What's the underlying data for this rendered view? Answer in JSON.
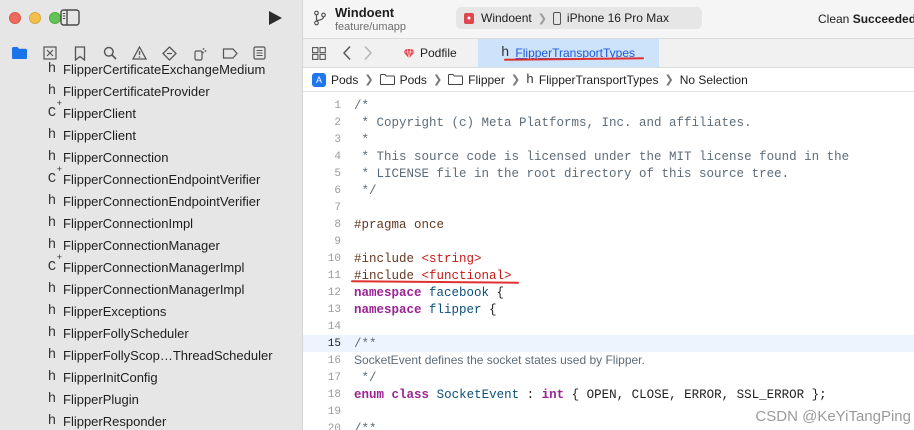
{
  "window": {
    "project": "Windoent",
    "branch": "feature/umapp",
    "scheme": "Windoent",
    "device": "iPhone 16 Pro Max",
    "status_prefix": "Clean ",
    "status_strong": "Succeeded"
  },
  "navigator": {
    "files": [
      {
        "badge": "h",
        "name": "FlipperCertificateExchangeMedium"
      },
      {
        "badge": "h",
        "name": "FlipperCertificateProvider"
      },
      {
        "badge": "C",
        "name": "FlipperClient"
      },
      {
        "badge": "h",
        "name": "FlipperClient"
      },
      {
        "badge": "h",
        "name": "FlipperConnection"
      },
      {
        "badge": "C",
        "name": "FlipperConnectionEndpointVerifier"
      },
      {
        "badge": "h",
        "name": "FlipperConnectionEndpointVerifier"
      },
      {
        "badge": "h",
        "name": "FlipperConnectionImpl"
      },
      {
        "badge": "h",
        "name": "FlipperConnectionManager"
      },
      {
        "badge": "C",
        "name": "FlipperConnectionManagerImpl"
      },
      {
        "badge": "h",
        "name": "FlipperConnectionManagerImpl"
      },
      {
        "badge": "h",
        "name": "FlipperExceptions"
      },
      {
        "badge": "h",
        "name": "FlipperFollyScheduler"
      },
      {
        "badge": "h",
        "name": "FlipperFollyScop…ThreadScheduler"
      },
      {
        "badge": "h",
        "name": "FlipperInitConfig"
      },
      {
        "badge": "h",
        "name": "FlipperPlugin"
      },
      {
        "badge": "h",
        "name": "FlipperResponder"
      }
    ]
  },
  "tabs": {
    "podfile": "Podfile",
    "active": "FlipperTransportTypes"
  },
  "breadcrumb": {
    "items": [
      "Pods",
      "Pods",
      "Flipper",
      "FlipperTransportTypes",
      "No Selection"
    ]
  },
  "editor": {
    "current_line": 15,
    "lines": [
      {
        "n": "1",
        "t": "/*"
      },
      {
        "n": "2",
        "t": " * Copyright (c) Meta Platforms, Inc. and affiliates."
      },
      {
        "n": "3",
        "t": " *"
      },
      {
        "n": "4",
        "t": " * This source code is licensed under the MIT license found in the"
      },
      {
        "n": "5",
        "t": " * LICENSE file in the root directory of this source tree."
      },
      {
        "n": "6",
        "t": " */"
      },
      {
        "n": "7",
        "t": ""
      },
      {
        "n": "8",
        "t": "#pragma once"
      },
      {
        "n": "9",
        "t": ""
      },
      {
        "n": "10",
        "t": "#include <string>"
      },
      {
        "n": "11",
        "t": "#include <functional>"
      },
      {
        "n": "12",
        "t": "namespace facebook {"
      },
      {
        "n": "13",
        "t": "namespace flipper {"
      },
      {
        "n": "14",
        "t": ""
      },
      {
        "n": "15",
        "t": "/**"
      },
      {
        "n": "16",
        "t": "SocketEvent defines the socket states used by Flipper."
      },
      {
        "n": "17",
        "t": " */"
      },
      {
        "n": "18",
        "t": "enum class SocketEvent : int { OPEN, CLOSE, ERROR, SSL_ERROR };"
      },
      {
        "n": "19",
        "t": ""
      },
      {
        "n": "20",
        "t": "/**"
      }
    ]
  },
  "watermark": "CSDN @KeYiTangPing",
  "colors": {
    "sidebar_bg": "#e6e6e6",
    "active_tab_bg": "#cde2fb",
    "annotation_red": "#e03131",
    "keyword": "#9b2393",
    "string": "#c41a16",
    "preprocessor": "#643820",
    "comment": "#5d6c79"
  }
}
